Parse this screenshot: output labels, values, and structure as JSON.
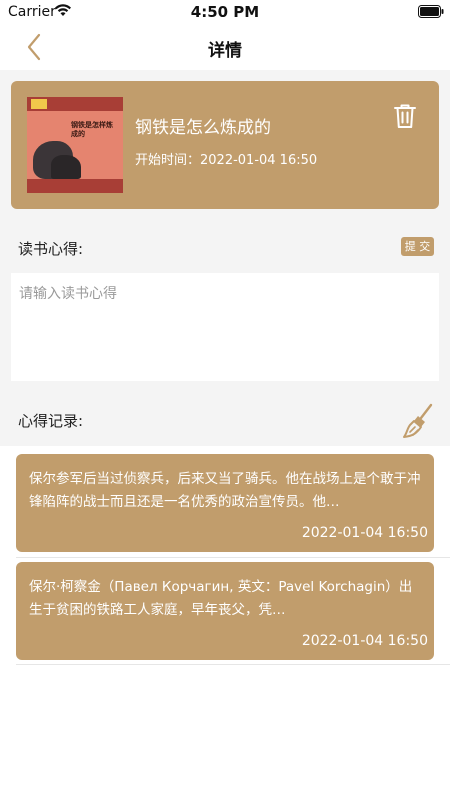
{
  "status_bar": {
    "carrier": "Carrier",
    "time": "4:50 PM"
  },
  "nav": {
    "title": "详情",
    "back_icon": "chevron-left-icon"
  },
  "book": {
    "title": "钢铁是怎么炼成的",
    "start_time": "开始时间：2022-01-04 16:50",
    "cover_text": "钢铁是怎样炼成的",
    "delete_icon": "trash-icon"
  },
  "notes": {
    "label": "读书心得:",
    "submit_label": "提 交",
    "placeholder": "请输入读书心得"
  },
  "records": {
    "label": "心得记录:",
    "clear_icon": "broom-icon",
    "items": [
      {
        "text": "保尔参军后当过侦察兵，后来又当了骑兵。他在战场上是个敢于冲锋陷阵的战士而且还是一名优秀的政治宣传员。他…",
        "time": "2022-01-04 16:50"
      },
      {
        "text": "保尔·柯察金（Павел Корчагин, 英文：Pavel Korchagin）出生于贫困的铁路工人家庭，早年丧父，凭…",
        "time": "2022-01-04 16:50"
      }
    ]
  },
  "colors": {
    "accent": "#c19d6c",
    "background": "#f4f4f4"
  }
}
